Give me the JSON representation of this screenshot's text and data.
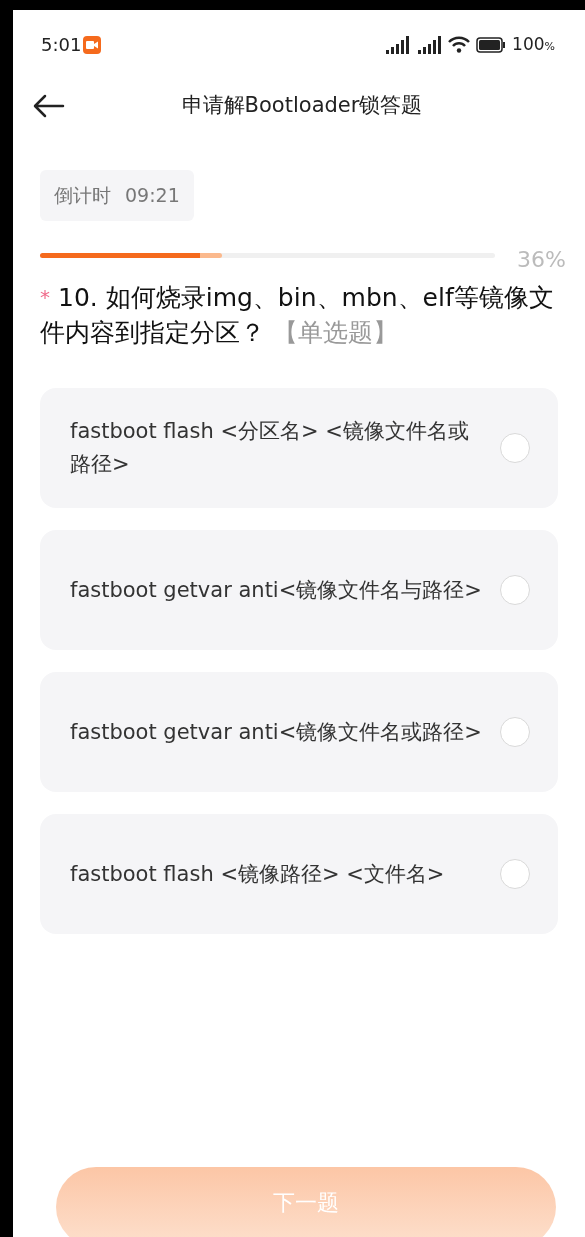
{
  "status_bar": {
    "time": "5:01",
    "battery": "100",
    "battery_unit": "%"
  },
  "header": {
    "title": "申请解Bootloader锁答题"
  },
  "timer": {
    "label": "倒计时",
    "value": "09:21"
  },
  "progress": {
    "level": 0.36,
    "reading": "36%"
  },
  "question": {
    "required_mark": "*",
    "text": "10. 如何烧录img、bin、mbn、elf等镜像文件内容到指定分区？",
    "type_tag": "【单选题】"
  },
  "options": [
    {
      "text": "fastboot flash <分区名> <镜像文件名或路径>",
      "selected": false
    },
    {
      "text": "fastboot getvar anti<镜像文件名与路径>",
      "selected": false
    },
    {
      "text": "fastboot getvar anti<镜像文件名或路径>",
      "selected": false
    },
    {
      "text": "fastboot flash <镜像路径> <文件名>",
      "selected": false
    }
  ],
  "next_button": {
    "label": "下一题",
    "disabled": true
  }
}
